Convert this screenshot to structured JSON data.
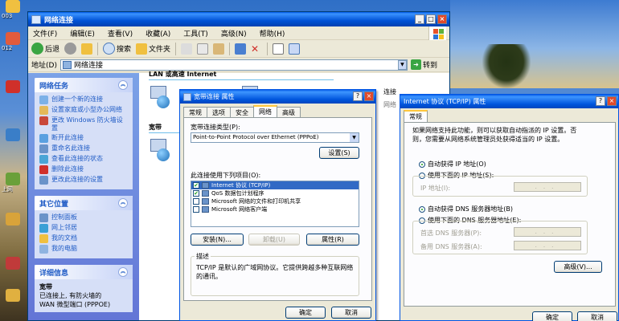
{
  "explorer": {
    "title": "网络连接",
    "menu": [
      "文件(F)",
      "编辑(E)",
      "查看(V)",
      "收藏(A)",
      "工具(T)",
      "高级(N)",
      "帮助(H)"
    ],
    "toolbar": {
      "back": "后退",
      "search": "搜索",
      "folders": "文件夹"
    },
    "address_label": "地址(D)",
    "address_value": "网络连接",
    "go_label": "转到",
    "sidebar": {
      "network_tasks": {
        "title": "网络任务",
        "items": [
          "创建一个新的连接",
          "设置家庭或小型办公网络",
          "更改 Windows 防火墙设置",
          "断开此连接",
          "重命名此连接",
          "查看此连接的状态",
          "删除此连接",
          "更改此连接的设置"
        ]
      },
      "other_places": {
        "title": "其它位置",
        "items": [
          "控制面板",
          "网上邻居",
          "我的文档",
          "我的电脑"
        ]
      },
      "details": {
        "title": "详细信息",
        "name": "宽带",
        "line1": "已连接上, 有防火墙的",
        "line2": "WAN 微型端口 (PPPOE)"
      }
    },
    "content": {
      "lan_header": "LAN 或高速 Internet",
      "broadband_header": "宽带",
      "lan_item_label": "连接",
      "lan_item_sub": "网络"
    }
  },
  "props_dialog": {
    "title": "宽带连接 属性",
    "tabs": [
      "常规",
      "选项",
      "安全",
      "网络",
      "高级"
    ],
    "active_tab": "网络",
    "type_label": "宽带连接类型(P):",
    "type_value": "Point-to-Point Protocol over Ethernet (PPPoE)",
    "settings_btn": "设置(S)",
    "items_label": "此连接使用下列项目(O):",
    "items": [
      {
        "label": "Internet 协议 (TCP/IP)",
        "checked": true
      },
      {
        "label": "QoS 数据包计划程序",
        "checked": true
      },
      {
        "label": "Microsoft 网络的文件和打印机共享",
        "checked": false
      },
      {
        "label": "Microsoft 网络客户端",
        "checked": false
      }
    ],
    "install_btn": "安装(N)...",
    "uninstall_btn": "卸载(U)",
    "properties_btn": "属性(R)",
    "desc_title": "描述",
    "desc_text": "TCP/IP 是默认的广域网协议。它提供跨越多种互联网络的通讯。",
    "ok_btn": "确定",
    "cancel_btn": "取消"
  },
  "tcpip_dialog": {
    "title": "Internet 协议 (TCP/IP) 属性",
    "tab": "常规",
    "intro": "如果网络支持此功能，则可以获取自动指派的 IP 设置。否则，您需要从网络系统管理员处获得适当的 IP 设置。",
    "auto_ip": "自动获得 IP 地址(O)",
    "manual_ip": "使用下面的 IP 地址(S):",
    "ip_label": "IP 地址(I):",
    "auto_dns": "自动获得 DNS 服务器地址(B)",
    "manual_dns": "使用下面的 DNS 服务器地址(E):",
    "pref_dns": "首选 DNS 服务器(P):",
    "alt_dns": "备用 DNS 服务器(A):",
    "advanced_btn": "高级(V)...",
    "ok_btn": "确定",
    "cancel_btn": "取消"
  },
  "desktop_labels": [
    "003",
    "012",
    "上网"
  ]
}
